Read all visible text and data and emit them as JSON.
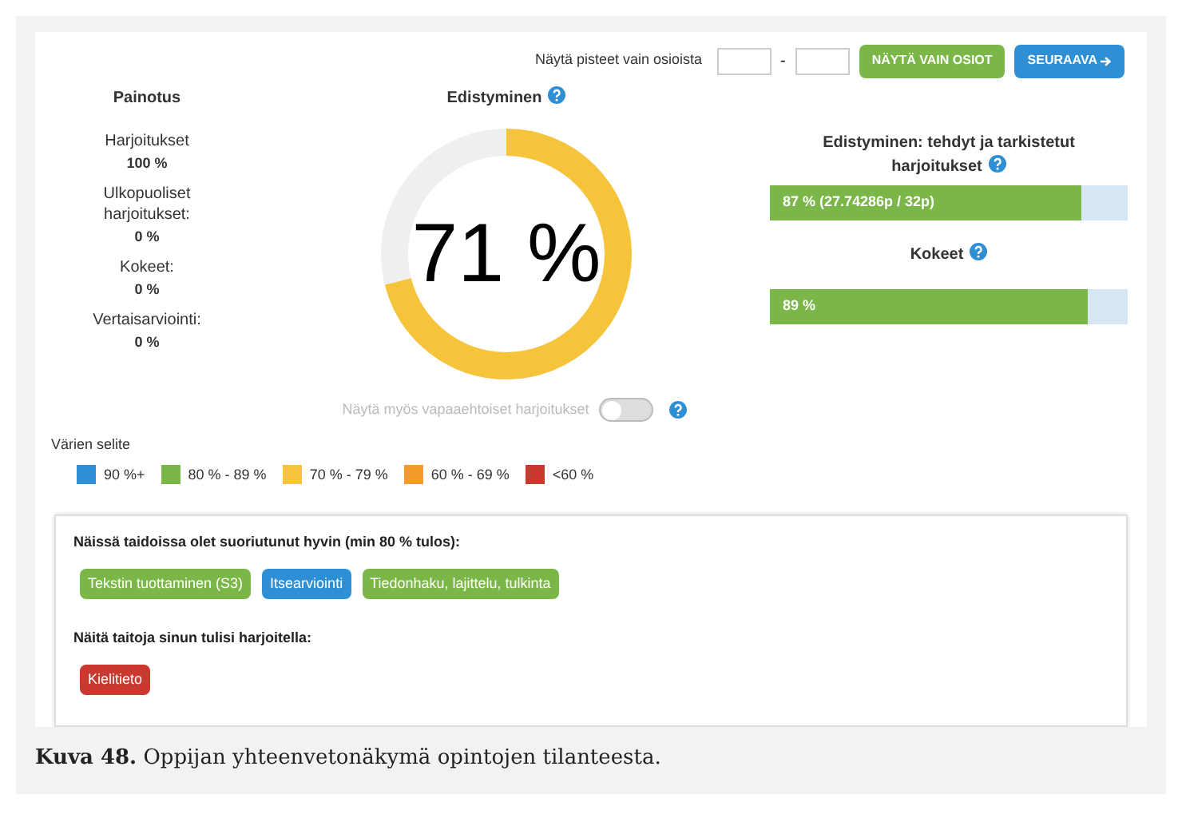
{
  "filter": {
    "label": "Näytä pisteet vain osioista",
    "separator": "-",
    "buttons": [
      {
        "label": "NÄYTÄ VAIN OSIOT",
        "kind": "green"
      },
      {
        "label": "SEURAAVA",
        "kind": "next"
      }
    ]
  },
  "weighting": {
    "title": "Painotus",
    "items": [
      {
        "label": "Harjoitukset",
        "value": "100 %"
      },
      {
        "label": "Ulkopuoliset harjoitukset:",
        "value": "0 %"
      },
      {
        "label": "Kokeet:",
        "value": "0 %"
      },
      {
        "label": "Vertaisarviointi:",
        "value": "0 %"
      }
    ]
  },
  "progress": {
    "title": "Edistyminen",
    "value": "71 %",
    "toggle": {
      "label": "Näytä myös vapaaehtoiset harjoitukset",
      "on": false
    }
  },
  "bars": [
    {
      "title": "Edistyminen: tehdyt ja tarkistetut harjoitukset",
      "level": 0.87,
      "reading": "87 % (27.74286p / 32p)"
    },
    {
      "title": "Kokeet",
      "level": 0.89,
      "reading": "89 %"
    }
  ],
  "legend": {
    "title": "Värien selite",
    "items": [
      {
        "label": "90 %+",
        "color": "#2f8fd5"
      },
      {
        "label": "80 % - 89 %",
        "color": "#7ab648"
      },
      {
        "label": "70 % - 79 %",
        "color": "#f6c43a"
      },
      {
        "label": "60 % - 69 %",
        "color": "#f59b2b"
      },
      {
        "label": "<60 %",
        "color": "#c9392f"
      }
    ]
  },
  "skills": [
    {
      "title": "Näissä taidoissa olet suoriutunut hyvin (min 80 % tulos):",
      "tags": [
        {
          "label": "Tekstin tuottaminen (S3)",
          "color": "#7ab648"
        },
        {
          "label": "Itsearviointi",
          "color": "#2f8fd5"
        },
        {
          "label": "Tiedonhaku, lajittelu, tulkinta",
          "color": "#7ab648"
        }
      ]
    },
    {
      "title": "Näitä taitoja sinun tulisi harjoitella:",
      "tags": [
        {
          "label": "Kielitieto",
          "color": "#c9392f"
        }
      ]
    }
  ],
  "caption": {
    "text": "**Kuva 48.** Oppijan yhteenvetonäkymä opintojen tilanteesta."
  }
}
